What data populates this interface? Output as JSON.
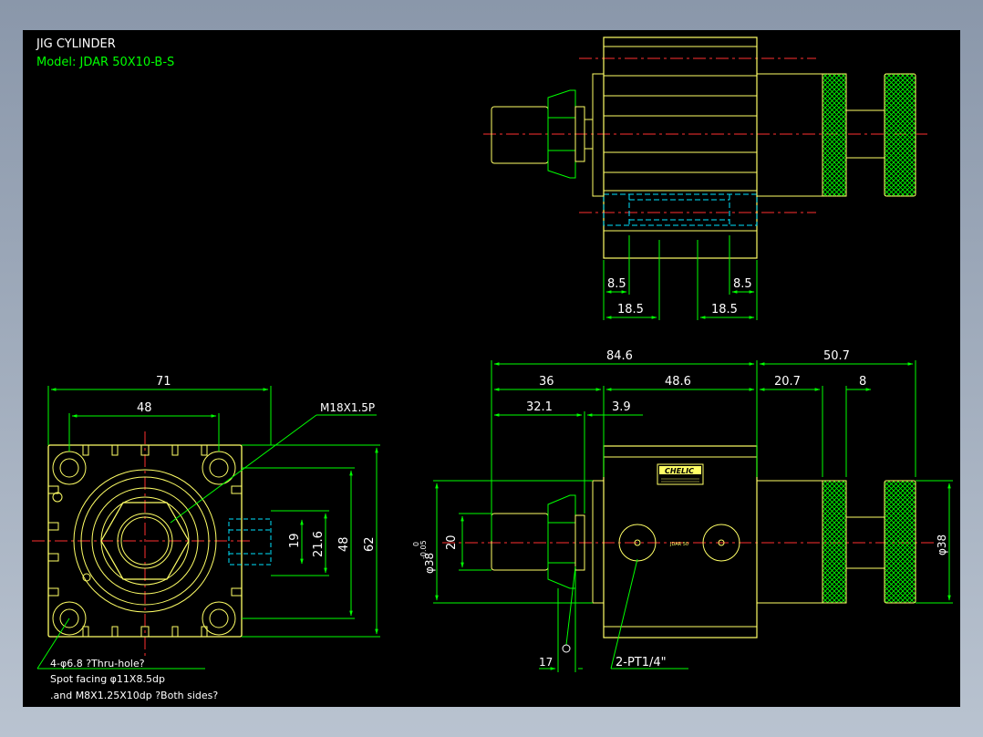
{
  "title_block": {
    "title": "JIG CYLINDER",
    "model": "Model:  JDAR 50X10-B-S"
  },
  "colors": {
    "background": "#000000",
    "frame": "#8a97aa",
    "outline": "#ffff66",
    "dimension": "#00ff00",
    "hidden": "#00e5ff",
    "centerline": "#ff3030",
    "knurl": "#00ff00"
  },
  "top_view": {
    "dims": {
      "d1": "8.5",
      "d2": "8.5",
      "d3": "18.5",
      "d4": "18.5"
    }
  },
  "front_view": {
    "dims": {
      "d71": "71",
      "d48": "48",
      "d19": "19",
      "d21_6": "21.6",
      "d48v": "48",
      "d62": "62"
    },
    "thread_label": "M18X1.5P",
    "note_line1": "4-φ6.8    ?Thru-hole?",
    "note_line2": "Spot facing  φ11X8.5dp",
    "note_line3": ".and M8X1.25X10dp ?Both sides?"
  },
  "side_view": {
    "dims": {
      "d84_6": "84.6",
      "d50_7": "50.7",
      "d36": "36",
      "d48_6": "48.6",
      "d20_7": "20.7",
      "d8": "8",
      "d32_1": "32.1",
      "d3_9": "3.9",
      "d20": "20",
      "d38": "φ38",
      "d17": "17"
    },
    "dia_main": "φ38",
    "tol_upper": "0",
    "tol_lower": "-0.05",
    "port_label": "2-PT1/4\"",
    "brand_label": "CHELIC",
    "model_stamp": "JDAR 50"
  }
}
